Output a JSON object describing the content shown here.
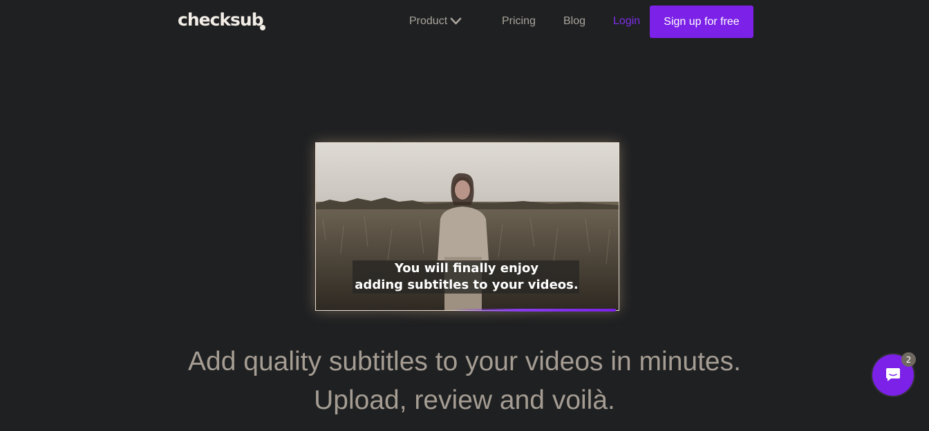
{
  "nav": {
    "logo": "checksub",
    "items": [
      {
        "label": "Product"
      },
      {
        "label": "Pricing"
      },
      {
        "label": "Blog"
      },
      {
        "label": "Login"
      }
    ],
    "signup_label": "Sign up for free",
    "accent_color": "#7c21e8"
  },
  "video": {
    "caption_line1": "You will finally enjoy",
    "caption_line2": "adding subtitles to your videos."
  },
  "hero": {
    "line1": "Add quality subtitles to your videos in minutes.",
    "line2": "Upload, review and voilà."
  },
  "chat": {
    "badge": "2",
    "icon": "chat-bubble-icon"
  }
}
